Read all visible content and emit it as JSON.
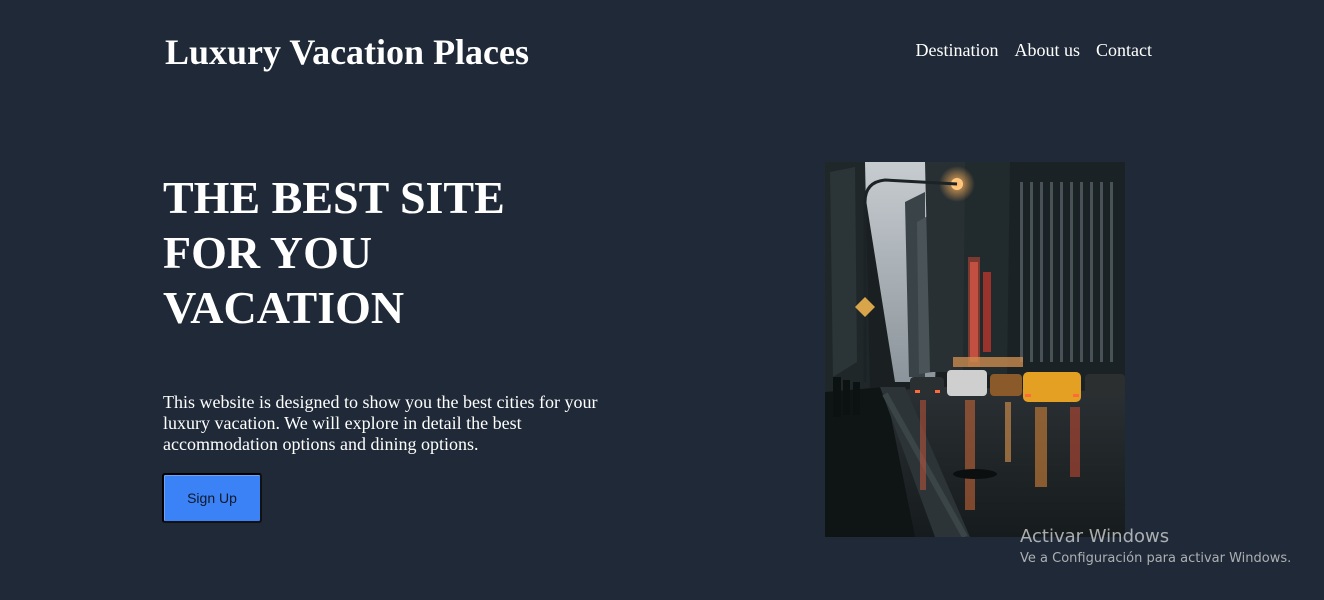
{
  "header": {
    "logo": "Luxury Vacation Places",
    "nav": [
      "Destination",
      "About us",
      "Contact"
    ]
  },
  "hero": {
    "title": "THE BEST SITE\nFOR YOU\nVACATION",
    "description": "This website is designed to show you the best cities for your luxury vacation. We will explore in detail the best accommodation options and dining options.",
    "cta_label": "Sign Up",
    "image": "city-street-night-photo"
  },
  "watermark": {
    "title": "Activar Windows",
    "subtitle": "Ve a Configuración para activar Windows."
  },
  "colors": {
    "background": "#1f2937",
    "cta": "#3b82f6"
  }
}
